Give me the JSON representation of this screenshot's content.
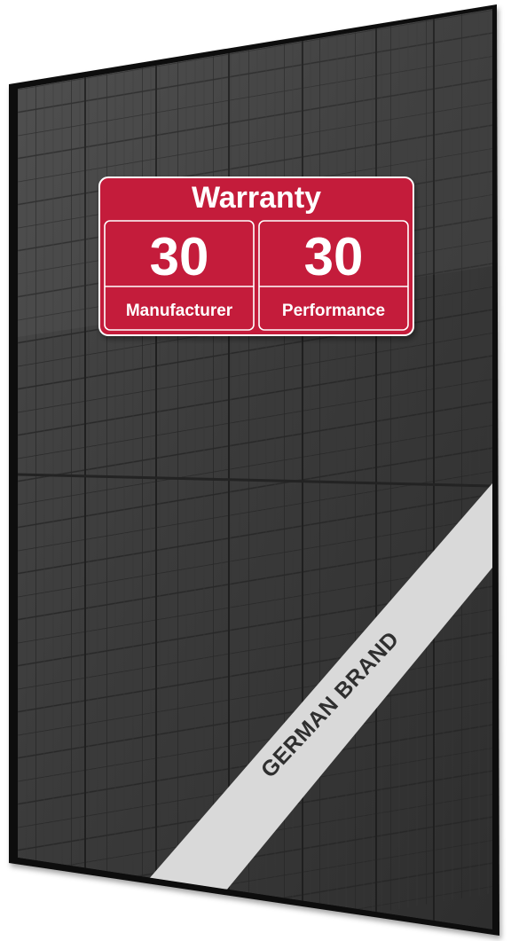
{
  "image": {
    "subject": "solar-panel",
    "colors": {
      "frame": "#121212",
      "cells": "#3a3a3a",
      "badge_red": "#c41f3a",
      "band": "#d9d9d9"
    }
  },
  "warranty_badge": {
    "title": "Warranty",
    "manufacturer_years": "30",
    "manufacturer_label": "Manufacturer",
    "performance_years": "30",
    "performance_label": "Performance"
  },
  "band": {
    "text": "GERMAN BRAND"
  }
}
